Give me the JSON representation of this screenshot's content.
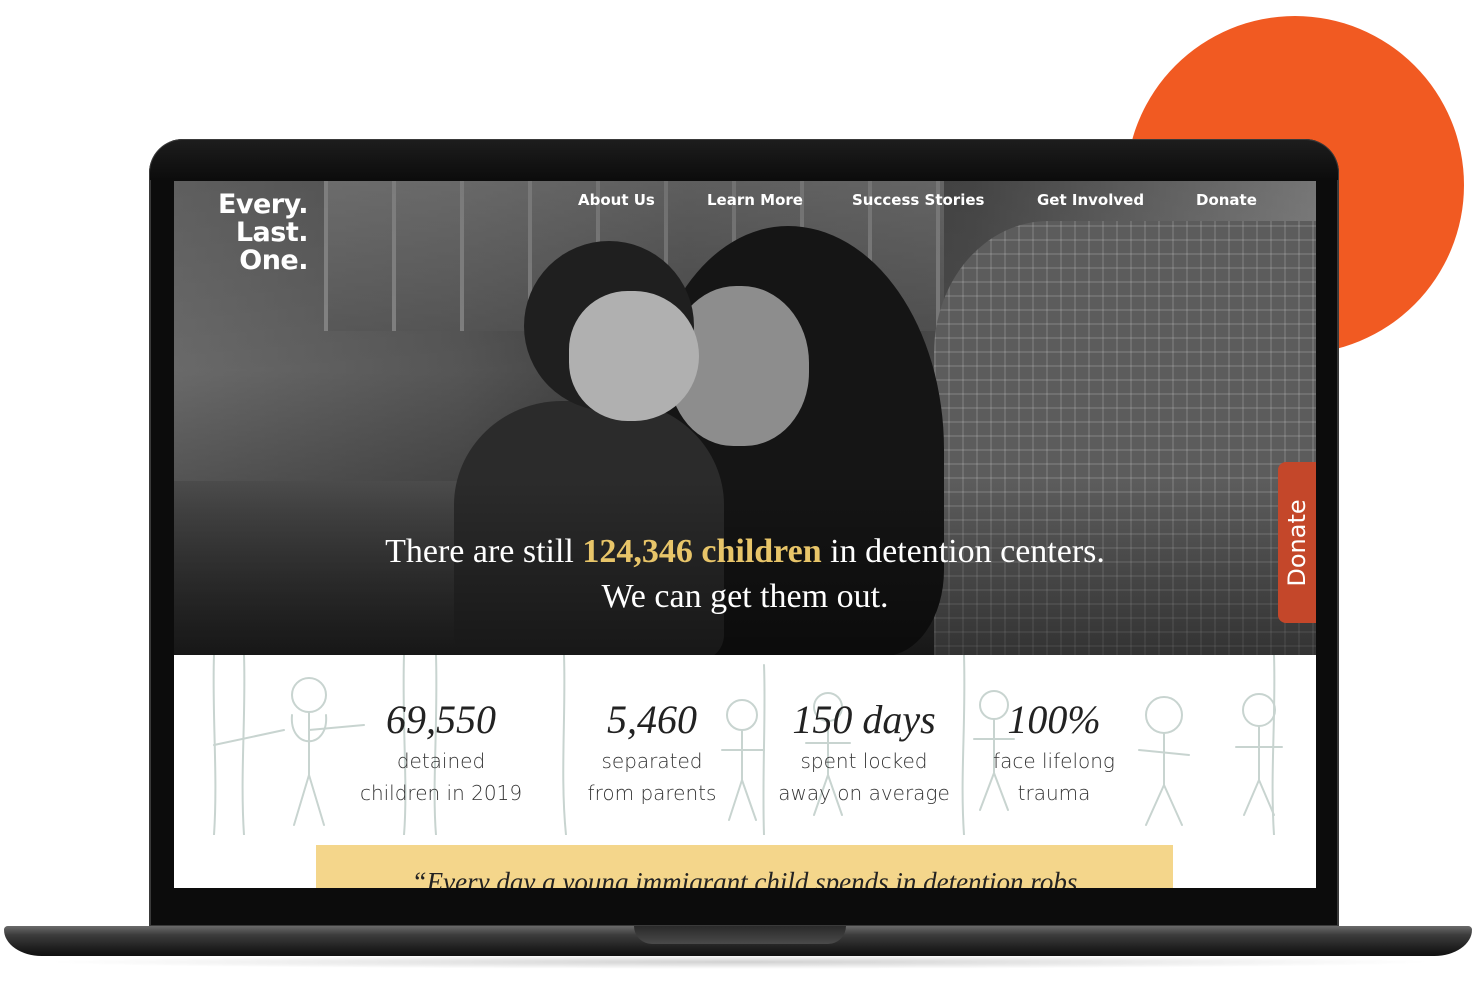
{
  "site": {
    "logo_lines": [
      "Every.",
      "Last.",
      "One."
    ],
    "nav": [
      "About Us",
      "Learn More",
      "Success Stories",
      "Get Involved",
      "Donate"
    ],
    "donate_tab": "Donate"
  },
  "hero": {
    "headline_before": "There are still ",
    "headline_highlight": "124,346 children",
    "headline_after": " in detention centers.",
    "headline_line2": "We can get them out."
  },
  "stats": [
    {
      "number": "69,550",
      "unit": "",
      "label_line1": "detained",
      "label_line2": "children in 2019"
    },
    {
      "number": "5,460",
      "unit": "",
      "label_line1": "separated",
      "label_line2": "from parents"
    },
    {
      "number": "150",
      "unit": " days",
      "label_line1": "spent locked",
      "label_line2": "away on average"
    },
    {
      "number": "100%",
      "unit": "",
      "label_line1": "face lifelong",
      "label_line2": "trauma"
    }
  ],
  "quote": {
    "text": "“Every day a young immigrant child spends in detention robs"
  },
  "colors": {
    "accent_orange": "#f15a22",
    "highlight_gold": "#e8c569",
    "donate_tab": "#c4472a",
    "quote_bg": "#f4d68b"
  }
}
